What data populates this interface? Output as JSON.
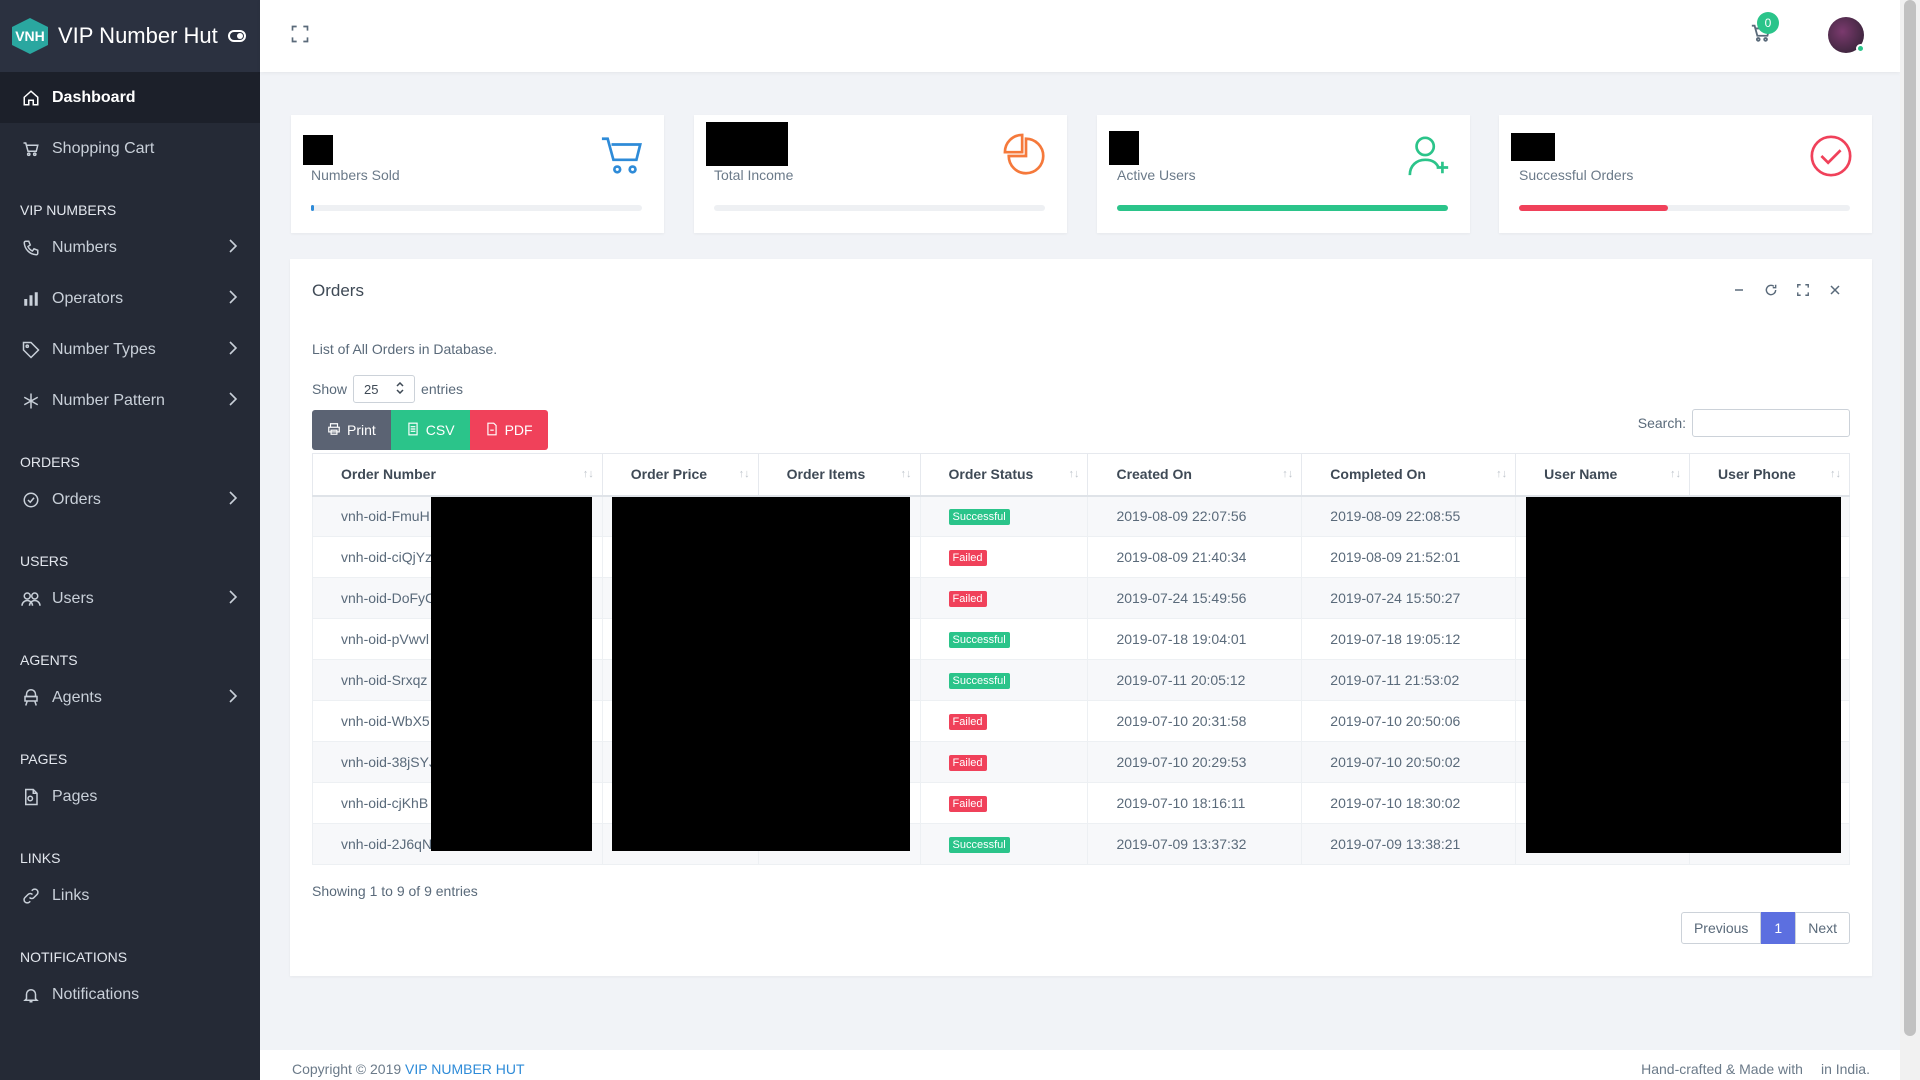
{
  "brand": {
    "logo_text": "VNH",
    "name": "VIP Number Hut"
  },
  "sidebar": {
    "dashboard": "Dashboard",
    "shopping_cart": "Shopping Cart",
    "sections": {
      "vip_numbers": "VIP NUMBERS",
      "orders": "ORDERS",
      "users": "USERS",
      "agents": "AGENTS",
      "pages": "PAGES",
      "links": "LINKS",
      "notifications": "NOTIFICATIONS"
    },
    "items": {
      "numbers": "Numbers",
      "operators": "Operators",
      "number_types": "Number Types",
      "number_pattern": "Number Pattern",
      "orders": "Orders",
      "users": "Users",
      "agents": "Agents",
      "pages": "Pages",
      "links": "Links",
      "notifications": "Notifications"
    }
  },
  "topbar": {
    "cart_count": "0"
  },
  "stats": {
    "numbers_sold": {
      "label": "Numbers Sold",
      "progress": 0.01,
      "color": "#2e8bd8"
    },
    "total_income": {
      "label": "Total Income",
      "progress": 0,
      "color": "#f5793b"
    },
    "active_users": {
      "label": "Active Users",
      "progress": 1.0,
      "color": "#2bc48a"
    },
    "successful_orders": {
      "label": "Successful Orders",
      "progress": 0.45,
      "color": "#f0415a"
    }
  },
  "orders": {
    "title": "Orders",
    "description": "List of All Orders in Database.",
    "show_label": "Show",
    "page_size": "25",
    "entries_label": "entries",
    "buttons": {
      "print": "Print",
      "csv": "CSV",
      "pdf": "PDF"
    },
    "search_label": "Search:",
    "columns": [
      "Order Number",
      "Order Price",
      "Order Items",
      "Order Status",
      "Created On",
      "Completed On",
      "User Name",
      "User Phone"
    ],
    "rows": [
      {
        "order_number": "vnh-oid-FmuH",
        "status": "Successful",
        "created": "2019-08-09 22:07:56",
        "completed": "2019-08-09 22:08:55"
      },
      {
        "order_number": "vnh-oid-ciQjYz",
        "status": "Failed",
        "created": "2019-08-09 21:40:34",
        "completed": "2019-08-09 21:52:01"
      },
      {
        "order_number": "vnh-oid-DoFyC",
        "status": "Failed",
        "created": "2019-07-24 15:49:56",
        "completed": "2019-07-24 15:50:27"
      },
      {
        "order_number": "vnh-oid-pVwvl",
        "status": "Successful",
        "created": "2019-07-18 19:04:01",
        "completed": "2019-07-18 19:05:12"
      },
      {
        "order_number": "vnh-oid-Srxqz",
        "status": "Successful",
        "created": "2019-07-11 20:05:12",
        "completed": "2019-07-11 21:53:02"
      },
      {
        "order_number": "vnh-oid-WbX5",
        "status": "Failed",
        "created": "2019-07-10 20:31:58",
        "completed": "2019-07-10 20:50:06"
      },
      {
        "order_number": "vnh-oid-38jSYJ",
        "status": "Failed",
        "created": "2019-07-10 20:29:53",
        "completed": "2019-07-10 20:50:02"
      },
      {
        "order_number": "vnh-oid-cjKhB",
        "status": "Failed",
        "created": "2019-07-10 18:16:11",
        "completed": "2019-07-10 18:30:02"
      },
      {
        "order_number": "vnh-oid-2J6qN",
        "status": "Successful",
        "created": "2019-07-09 13:37:32",
        "completed": "2019-07-09 13:38:21"
      }
    ],
    "info": "Showing 1 to 9 of 9 entries",
    "pagination": {
      "previous": "Previous",
      "current": "1",
      "next": "Next"
    }
  },
  "footer": {
    "copyright": "Copyright © 2019",
    "company": "VIP NUMBER HUT",
    "made_prefix": "Hand-crafted & Made with",
    "made_suffix": "in India."
  }
}
